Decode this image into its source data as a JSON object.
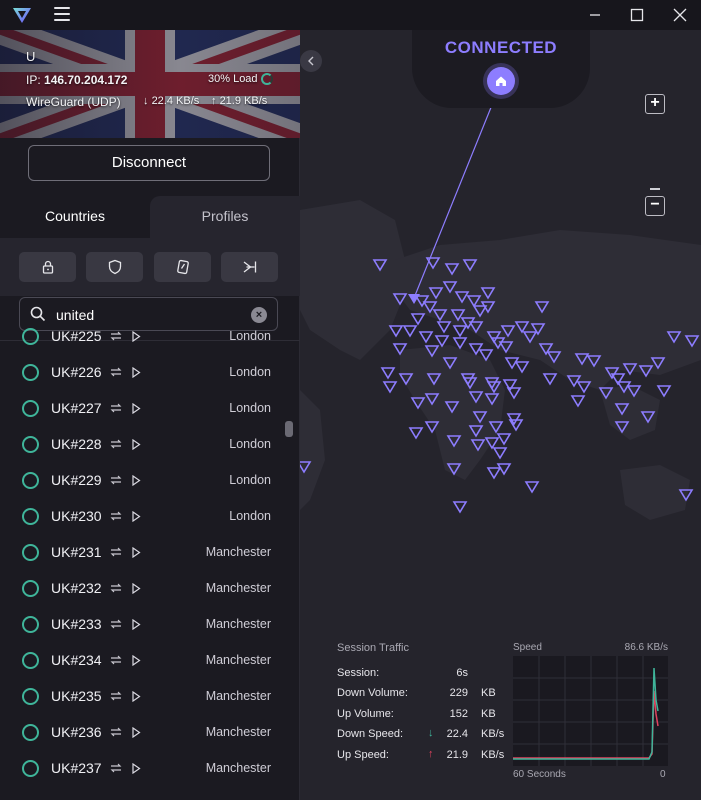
{
  "titlebar": {
    "logo_icon": "protonvpn-logo",
    "menu_icon": "hamburger-icon",
    "controls": [
      "minimize",
      "maximize",
      "close"
    ]
  },
  "connection": {
    "server_label": "U",
    "ip_label": "IP:",
    "ip": "146.70.204.172",
    "load": "30% Load",
    "protocol": "WireGuard (UDP)",
    "down_speed": "22.4 KB/s",
    "up_speed": "21.9 KB/s",
    "disconnect_label": "Disconnect"
  },
  "tabs": [
    {
      "label": "Countries",
      "active": true
    },
    {
      "label": "Profiles",
      "active": false
    }
  ],
  "filters": [
    {
      "icon": "lock-icon",
      "name": "secure-core"
    },
    {
      "icon": "shield-icon",
      "name": "netshield"
    },
    {
      "icon": "card-icon",
      "name": "p2p"
    },
    {
      "icon": "tor-icon",
      "name": "tor"
    }
  ],
  "search": {
    "value": "united",
    "placeholder": "Search"
  },
  "servers": [
    {
      "name": "UK#225",
      "city": "London"
    },
    {
      "name": "UK#226",
      "city": "London"
    },
    {
      "name": "UK#227",
      "city": "London"
    },
    {
      "name": "UK#228",
      "city": "London"
    },
    {
      "name": "UK#229",
      "city": "London"
    },
    {
      "name": "UK#230",
      "city": "London"
    },
    {
      "name": "UK#231",
      "city": "Manchester"
    },
    {
      "name": "UK#232",
      "city": "Manchester"
    },
    {
      "name": "UK#233",
      "city": "Manchester"
    },
    {
      "name": "UK#234",
      "city": "Manchester"
    },
    {
      "name": "UK#235",
      "city": "Manchester"
    },
    {
      "name": "UK#236",
      "city": "Manchester"
    },
    {
      "name": "UK#237",
      "city": "Manchester"
    }
  ],
  "map": {
    "status": "CONNECTED",
    "home_icon": "home-icon",
    "zoom_in": "+",
    "zoom_out": "−"
  },
  "traffic": {
    "title": "Session Traffic",
    "rows": [
      {
        "label": "Session:",
        "value": "6s",
        "unit": ""
      },
      {
        "label": "Down Volume:",
        "value": "229",
        "unit": "KB"
      },
      {
        "label": "Up Volume:",
        "value": "152",
        "unit": "KB"
      },
      {
        "label": "Down Speed:",
        "value": "22.4",
        "unit": "KB/s"
      },
      {
        "label": "Up Speed:",
        "value": "21.9",
        "unit": "KB/s"
      }
    ],
    "speed_label": "Speed",
    "speed_max": "86.6 KB/s",
    "axis_left": "60 Seconds",
    "axis_right": "0"
  },
  "colors": {
    "accent": "#8d7dff",
    "connected_ring": "#3fb59a",
    "down_arrow": "#3fb59a",
    "up_arrow": "#e0435e"
  }
}
